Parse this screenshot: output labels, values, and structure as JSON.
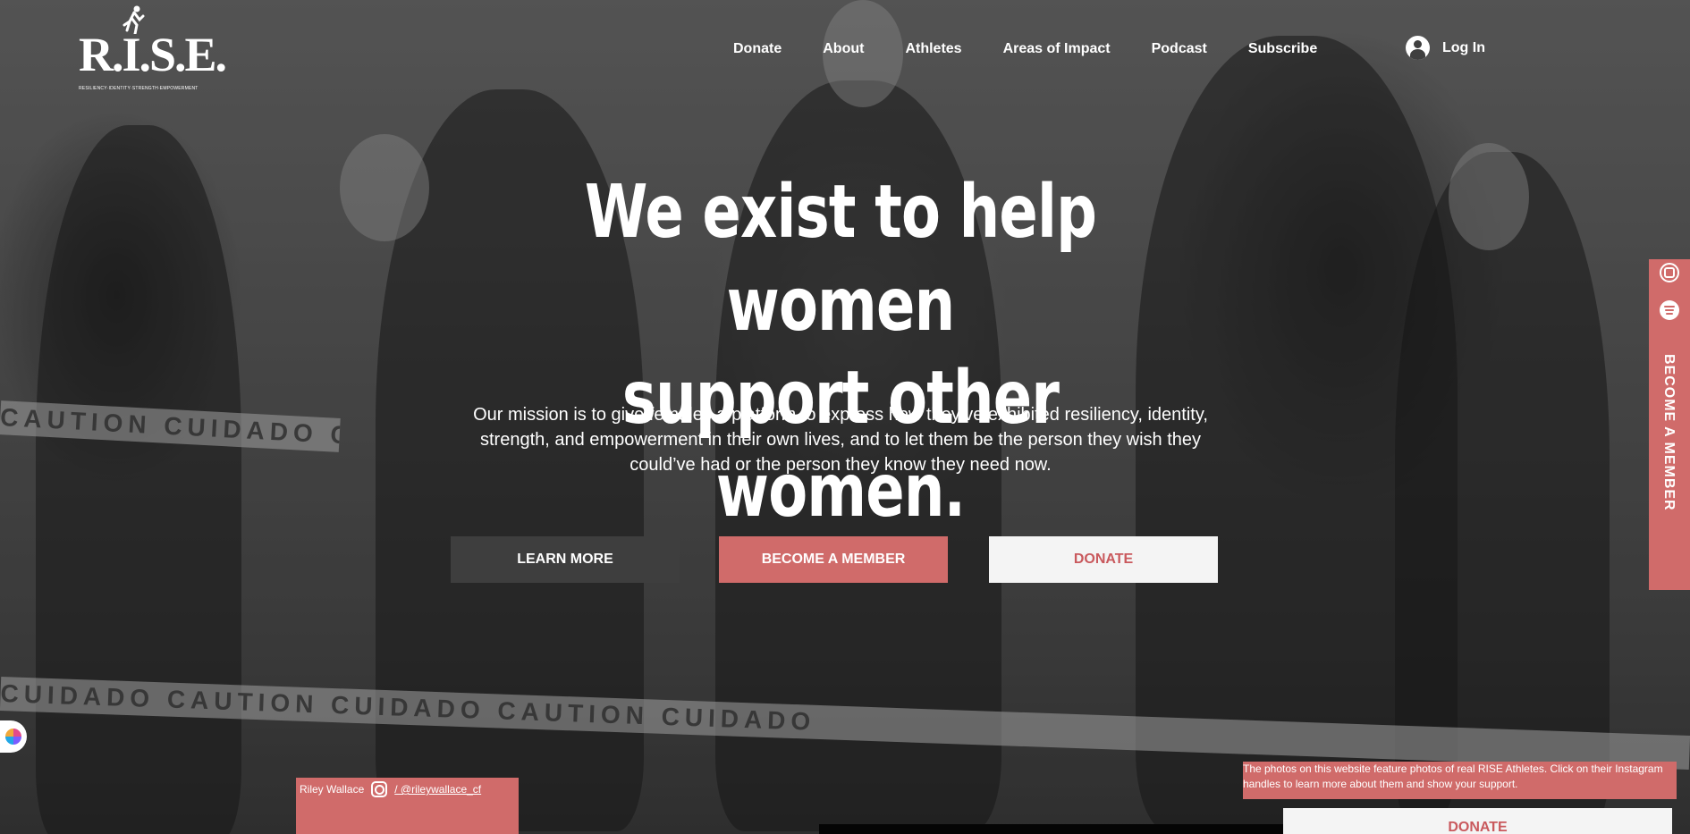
{
  "brand": {
    "logo_text": "R.I.S.E.",
    "logo_subtitle": "RESILIENCY·IDENTITY·STRENGTH·EMPOWERMENT"
  },
  "nav": {
    "items": [
      {
        "label": "Donate"
      },
      {
        "label": "About"
      },
      {
        "label": "Athletes"
      },
      {
        "label": "Areas of Impact"
      },
      {
        "label": "Podcast"
      },
      {
        "label": "Subscribe"
      }
    ]
  },
  "login": {
    "label": "Log In",
    "icon": "user-icon"
  },
  "hero": {
    "headline_line1": "We exist to help women",
    "headline_line2": "support other women.",
    "mission": "Our mission is to give females a platform to express how they’ve exhibited resiliency, identity, strength, and empowerment in their own lives, and to let them be the person they wish they could’ve had or the person they know they need now."
  },
  "buttons": {
    "learn_more": "LEARN MORE",
    "become_member": "BECOME A MEMBER",
    "donate": "DONATE"
  },
  "sidebar": {
    "label": "BECOME A MEMBER",
    "icons": [
      "instagram-icon",
      "spotify-icon"
    ]
  },
  "background_tape": {
    "text_top": "CAUTION CUIDADO CAUTION",
    "text_bottom": "CUIDADO CAUTION CUIDADO CAUTION CUIDADO"
  },
  "credit": {
    "name": "Riley Wallace",
    "handle": "/ @rileywallace_cf"
  },
  "note": {
    "text": "The photos on this website feature photos of real RISE Athletes. Click on their Instagram handles to learn more about them and show your support."
  },
  "bottom_donate": {
    "label": "DONATE"
  },
  "colors": {
    "accent": "#d06b6a",
    "donate_text": "#c9595d",
    "light_button": "#f4f4f4",
    "dark_button": "#3e3e3e"
  }
}
